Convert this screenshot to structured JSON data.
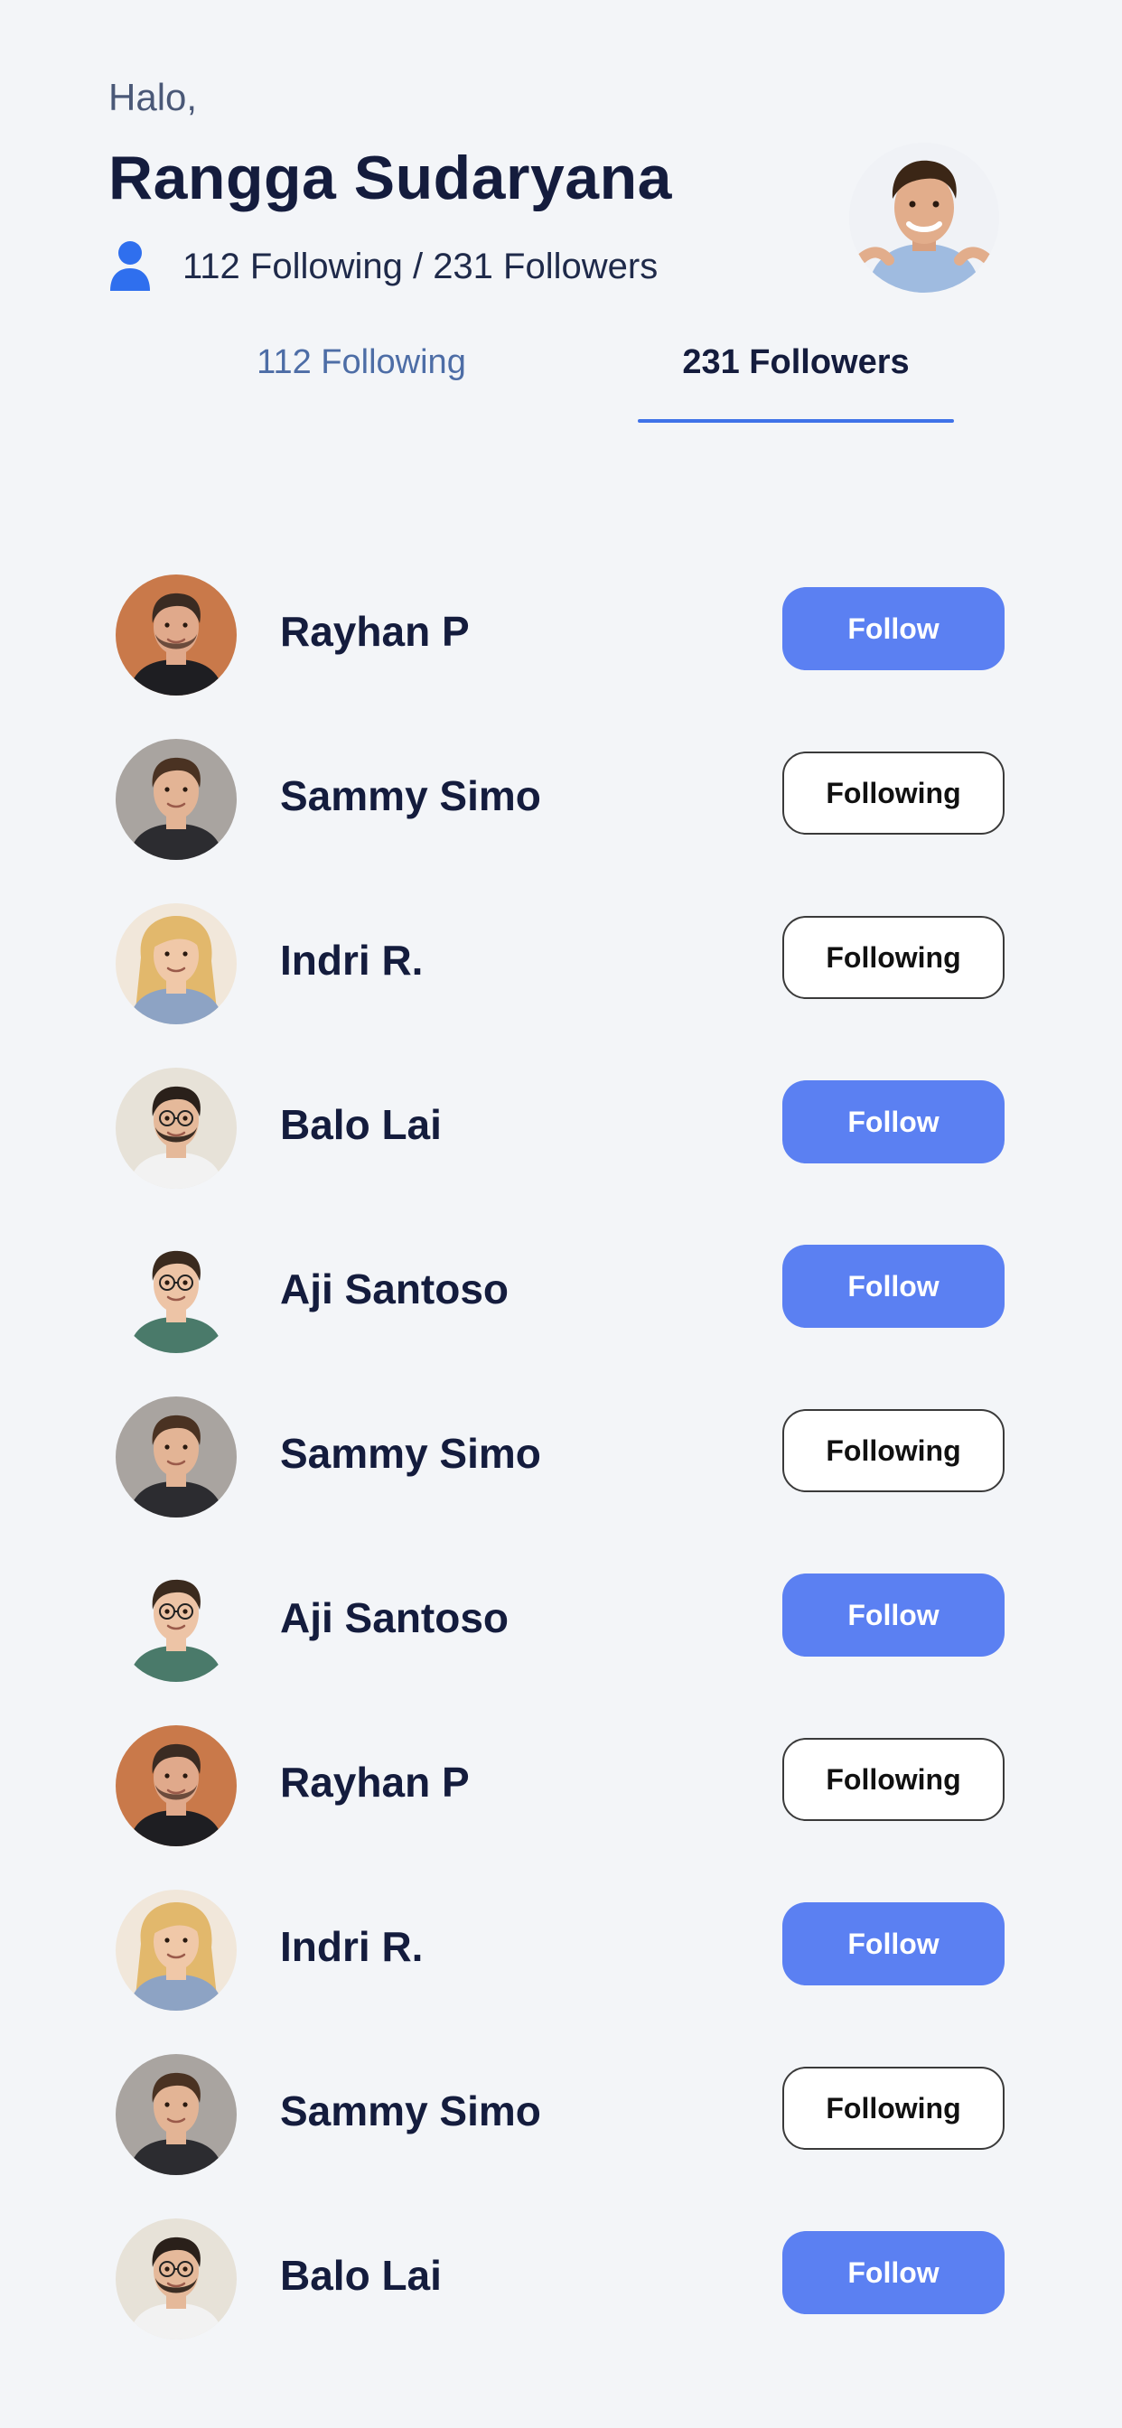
{
  "header": {
    "greeting": "Halo,",
    "user_name": "Rangga Sudaryana",
    "stats": "112 Following / 231 Followers"
  },
  "tabs": {
    "following_label": "112 Following",
    "followers_label": "231 Followers",
    "active": "followers"
  },
  "colors": {
    "accent": "#5b80f2",
    "text_dark": "#141c3d",
    "background": "#f3f5f8"
  },
  "list": [
    {
      "name": "Rayhan P",
      "button": "Follow",
      "state": "follow"
    },
    {
      "name": "Sammy Simo",
      "button": "Following",
      "state": "following"
    },
    {
      "name": "Indri R.",
      "button": "Following",
      "state": "following"
    },
    {
      "name": "Balo Lai",
      "button": "Follow",
      "state": "follow"
    },
    {
      "name": "Aji Santoso",
      "button": "Follow",
      "state": "follow"
    },
    {
      "name": "Sammy Simo",
      "button": "Following",
      "state": "following"
    },
    {
      "name": "Aji Santoso",
      "button": "Follow",
      "state": "follow"
    },
    {
      "name": "Rayhan P",
      "button": "Following",
      "state": "following"
    },
    {
      "name": "Indri R.",
      "button": "Follow",
      "state": "follow"
    },
    {
      "name": "Sammy Simo",
      "button": "Following",
      "state": "following"
    },
    {
      "name": "Balo Lai",
      "button": "Follow",
      "state": "follow"
    }
  ]
}
